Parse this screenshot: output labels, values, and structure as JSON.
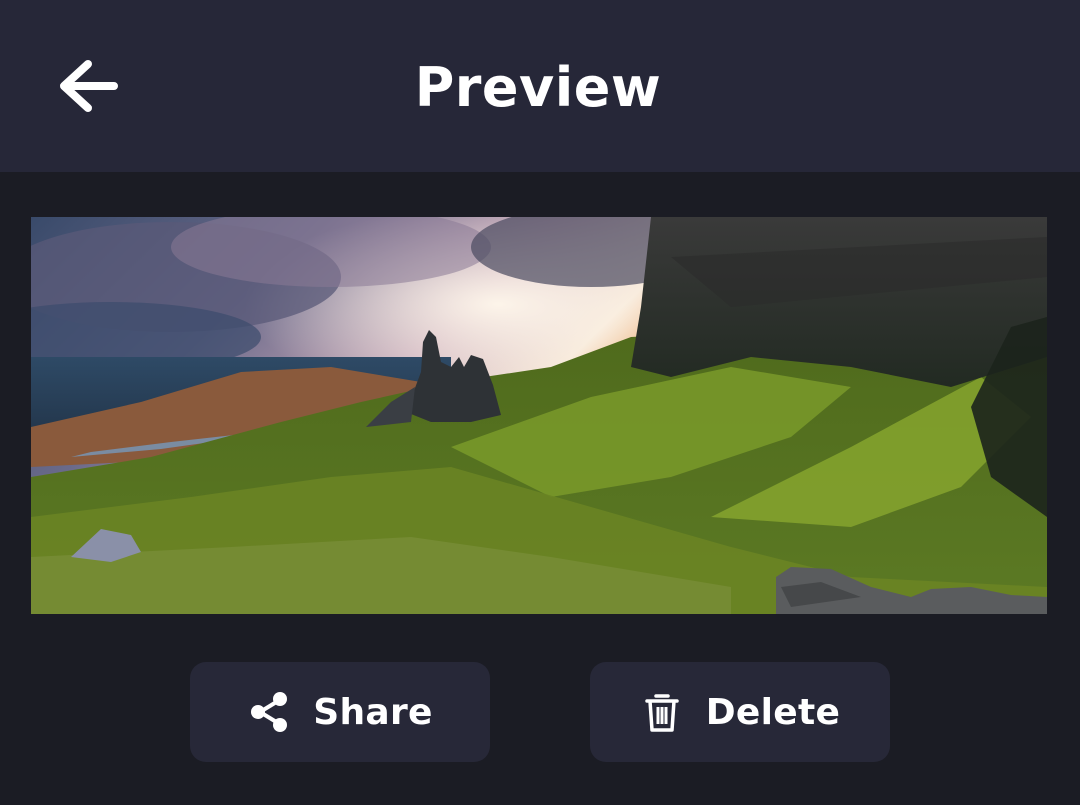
{
  "header": {
    "title": "Preview",
    "back_icon": "arrow-left-icon"
  },
  "preview": {
    "image_subject": "landscape-photo"
  },
  "actions": {
    "share": {
      "label": "Share",
      "icon": "share-icon"
    },
    "delete": {
      "label": "Delete",
      "icon": "trash-icon"
    }
  },
  "colors": {
    "background": "#1b1c24",
    "header": "#262738",
    "button": "#272838",
    "text": "#ffffff"
  }
}
